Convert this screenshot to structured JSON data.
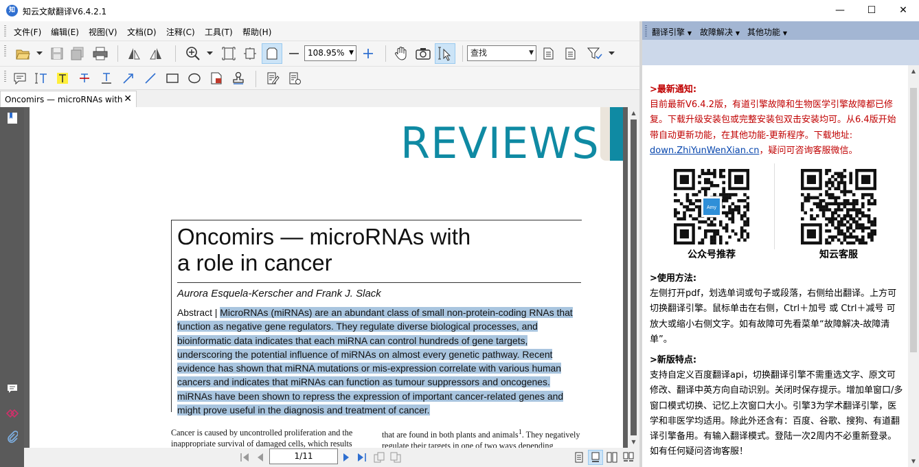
{
  "window": {
    "title": "知云文献翻译V6.4.2.1",
    "app_icon_text": "知",
    "minimize": "—",
    "maximize": "☐",
    "close": "✕"
  },
  "menubar": {
    "items": [
      "文件(F)",
      "编辑(E)",
      "视图(V)",
      "文档(D)",
      "注释(C)",
      "工具(T)",
      "帮助(H)"
    ]
  },
  "toolbar": {
    "zoom_value": "108.95%",
    "find_placeholder": "查找"
  },
  "tab": {
    "label": "Oncomirs — microRNAs with",
    "close": "✕"
  },
  "document": {
    "header": "REVIEWS",
    "title_line1": "Oncomirs — microRNAs with",
    "title_line2": "a role in cancer",
    "authors": "Aurora Esquela-Kerscher and Frank J. Slack",
    "abstract_label": "Abstract | ",
    "abstract_text": "MicroRNAs (miRNAs) are an abundant class of small non-protein-coding RNAs that function as negative gene regulators. They regulate diverse biological processes, and bioinformatic data indicates that each miRNA can control hundreds of gene targets, underscoring the potential influence of miRNAs on almost every genetic pathway. Recent evidence has shown that miRNA mutations or mis-expression correlate with various human cancers and indicates that miRNAs can function as tumour suppressors and oncogenes. miRNAs have been shown to repress the expression of important cancer-related genes and might prove useful in the diagnosis and treatment of cancer.",
    "body_left": "Cancer is caused by uncontrolled proliferation and the inappropriate survival of damaged cells, which results",
    "body_right_a": "that are found in both plants and animals",
    "body_right_sup": "1",
    "body_right_b": ". They negatively regulate their targets in one of two ways depending"
  },
  "navigation": {
    "page_indicator": "1/11"
  },
  "right_panel": {
    "menu": [
      "翻译引擎",
      "故障解决",
      "其他功能"
    ],
    "notice_heading": ">最新通知:",
    "notice_text": "目前最新V6.4.2版，有道引擎故障和生物医学引擎故障都已修复。下载升级安装包或完整安装包双击安装均可。从6.4版开始带自动更新功能，在其他功能-更新程序。下载地址:",
    "notice_link": "down.ZhiYunWenXian.cn",
    "notice_tail": "，疑问可咨询客服微信。",
    "qr_left_label": "公众号推荐",
    "qr_left_badge": "Amy",
    "qr_right_label": "知云客服",
    "usage_heading": ">使用方法:",
    "usage_text": "左侧打开pdf，划选单词或句子或段落，右侧给出翻译。上方可切换翻译引擎。鼠标单击在右侧，Ctrl＋加号 或 Ctrl＋减号 可放大或缩小右侧文字。如有故障可先看菜单“故障解决-故障清单”。",
    "features_heading": ">新版特点:",
    "features_text": "支持自定义百度翻译api，切换翻译引擎不需重选文字、原文可修改、翻译中英方向自动识别。关闭时保存提示。增加单窗口/多窗口模式切换、记忆上次窗口大小。引擎3为学术翻译引擎，医学和非医学均适用。除此外还含有：百度、谷歌、搜狗、有道翻译引擎备用。有输入翻译模式。登陆一次2周内不必重新登录。如有任何疑问咨询客服！"
  },
  "colors": {
    "accent_teal": "#0f8aa3",
    "highlight": "#a9c5df",
    "notice_red": "#c00000",
    "right_header": "#a3b6d3"
  }
}
